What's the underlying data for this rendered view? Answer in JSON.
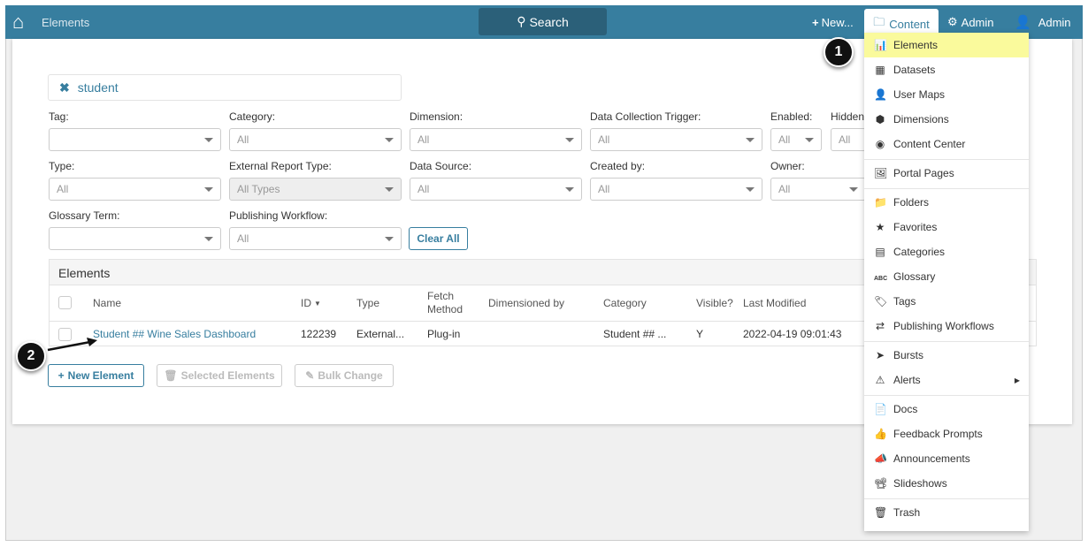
{
  "topbar": {
    "title": "Elements",
    "search": "Search",
    "new": "New...",
    "content": "Content",
    "admin_settings": "Admin",
    "admin_user": "Admin"
  },
  "search_filter": {
    "value": "student"
  },
  "filters": {
    "tag": {
      "label": "Tag:",
      "value": ""
    },
    "category": {
      "label": "Category:",
      "value": "All"
    },
    "dimension": {
      "label": "Dimension:",
      "value": "All"
    },
    "trigger": {
      "label": "Data Collection Trigger:",
      "value": "All"
    },
    "enabled": {
      "label": "Enabled:",
      "value": "All"
    },
    "hidden": {
      "label": "Hidden",
      "value": "All"
    },
    "type": {
      "label": "Type:",
      "value": "All"
    },
    "ext_type": {
      "label": "External Report Type:",
      "value": "All Types"
    },
    "source": {
      "label": "Data Source:",
      "value": "All"
    },
    "created_by": {
      "label": "Created by:",
      "value": "All"
    },
    "owner": {
      "label": "Owner:",
      "value": "All"
    },
    "glossary": {
      "label": "Glossary Term:",
      "value": ""
    },
    "workflow": {
      "label": "Publishing Workflow:",
      "value": "All"
    },
    "clear_all": "Clear All"
  },
  "table": {
    "title": "Elements",
    "columns": [
      "Name",
      "ID",
      "Type",
      "Fetch Method",
      "Dimensioned by",
      "Category",
      "Visible?",
      "Last Modified"
    ],
    "rows": [
      {
        "name": "Student ## Wine Sales Dashboard",
        "id": "122239",
        "type": "External...",
        "fetch": "Plug-in",
        "dimensioned": "",
        "category": "Student ## ...",
        "visible": "Y",
        "modified": "2022-04-19 09:01:43"
      }
    ]
  },
  "actions": {
    "new_element": "New Element",
    "selected": "Selected Elements",
    "bulk": "Bulk Change"
  },
  "menu": {
    "items": [
      "Elements",
      "Datasets",
      "User Maps",
      "Dimensions",
      "Content Center",
      "Portal Pages",
      "Folders",
      "Favorites",
      "Categories",
      "Glossary",
      "Tags",
      "Publishing Workflows",
      "Bursts",
      "Alerts",
      "Docs",
      "Feedback Prompts",
      "Announcements",
      "Slideshows",
      "Trash"
    ]
  },
  "callouts": [
    "1",
    "2"
  ],
  "colors": {
    "brand": "#377e9f",
    "highlight": "#fafa9c"
  }
}
